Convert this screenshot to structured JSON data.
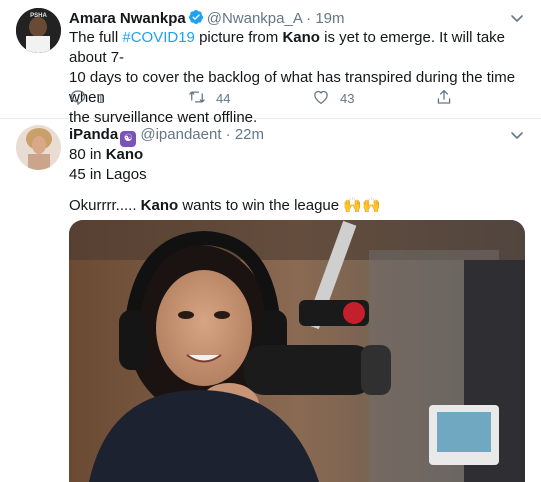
{
  "tweets": [
    {
      "author_name": "Amara Nwankpa",
      "handle": "@Nwankpa_A",
      "separator": "·",
      "time": "19m",
      "text_parts": {
        "p1": "The full ",
        "hashtag": "#COVID19",
        "p2": " picture from ",
        "bold": "Kano",
        "p3": " is yet to emerge. It will take about 7-",
        "line2": "10 days to cover the backlog of what has transpired during the time when",
        "line3": "the surveillance went offline."
      },
      "replies": "1",
      "retweets": "44",
      "likes": "43",
      "avatar_text": "PSHA"
    },
    {
      "author_name": "iPanda",
      "handle": "@ipandaent",
      "separator": "·",
      "time": "22m",
      "line1_num": "80 in ",
      "line1_bold": "Kano",
      "line2": "45 in Lagos",
      "line3_pre": "Okurrrr..... ",
      "line3_bold": "Kano",
      "line3_post": " wants to win the league ",
      "emoji": "🙌🙌"
    }
  ],
  "colors": {
    "link": "#1da1f2",
    "secondary_text": "#657786",
    "divider": "#e6ecf0",
    "verified": "#1da1f2"
  },
  "icons": [
    "verified-badge-icon",
    "caret-down-icon",
    "reply-icon",
    "retweet-icon",
    "like-icon",
    "share-icon"
  ]
}
